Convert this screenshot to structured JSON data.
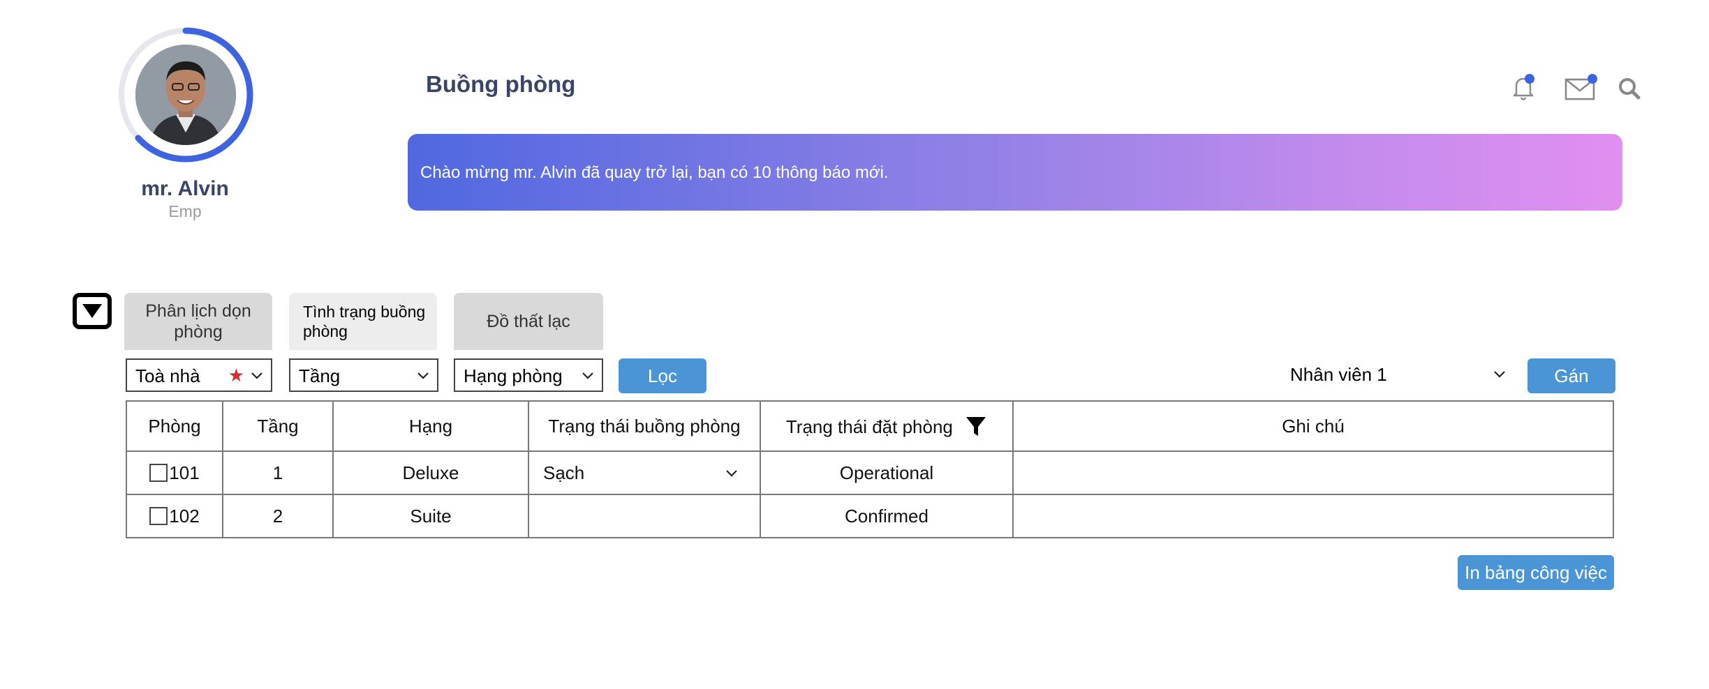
{
  "user": {
    "name": "mr. Alvin",
    "role": "Emp"
  },
  "header": {
    "title": "Buồng phòng",
    "icons": [
      "bell-icon",
      "mail-icon",
      "search-icon"
    ],
    "welcome": "Chào mừng mr. Alvin đã quay trở lại, bạn có 10 thông báo mới."
  },
  "tabs": [
    {
      "label": "Phân lịch dọn phòng",
      "active": false
    },
    {
      "label": "Tình trạng buồng phòng",
      "active": true
    },
    {
      "label": "Đồ thất lạc",
      "active": false
    }
  ],
  "filters": {
    "building": "Toà nhà",
    "floor": "Tầng",
    "room_class": "Hạng phòng",
    "filter_button": "Lọc",
    "staff": "Nhân viên 1",
    "assign_button": "Gán"
  },
  "table": {
    "headers": [
      "Phòng",
      "Tầng",
      "Hạng",
      "Trạng thái buồng phòng",
      "Trạng thái đặt phòng",
      "Ghi chú"
    ],
    "rows": [
      {
        "room": "101",
        "floor": "1",
        "class": "Deluxe",
        "housekeeping": "Sạch",
        "booking": "Operational",
        "note": ""
      },
      {
        "room": "102",
        "floor": "2",
        "class": "Suite",
        "housekeeping": "",
        "booking": "Confirmed",
        "note": ""
      }
    ]
  },
  "print_button": "In bảng công việc",
  "colors": {
    "accent": "#4b95d6",
    "title": "#3a4466",
    "notification_dot": "#3d63e0",
    "banner_start": "#5068e0",
    "banner_end": "#e18ff0"
  }
}
